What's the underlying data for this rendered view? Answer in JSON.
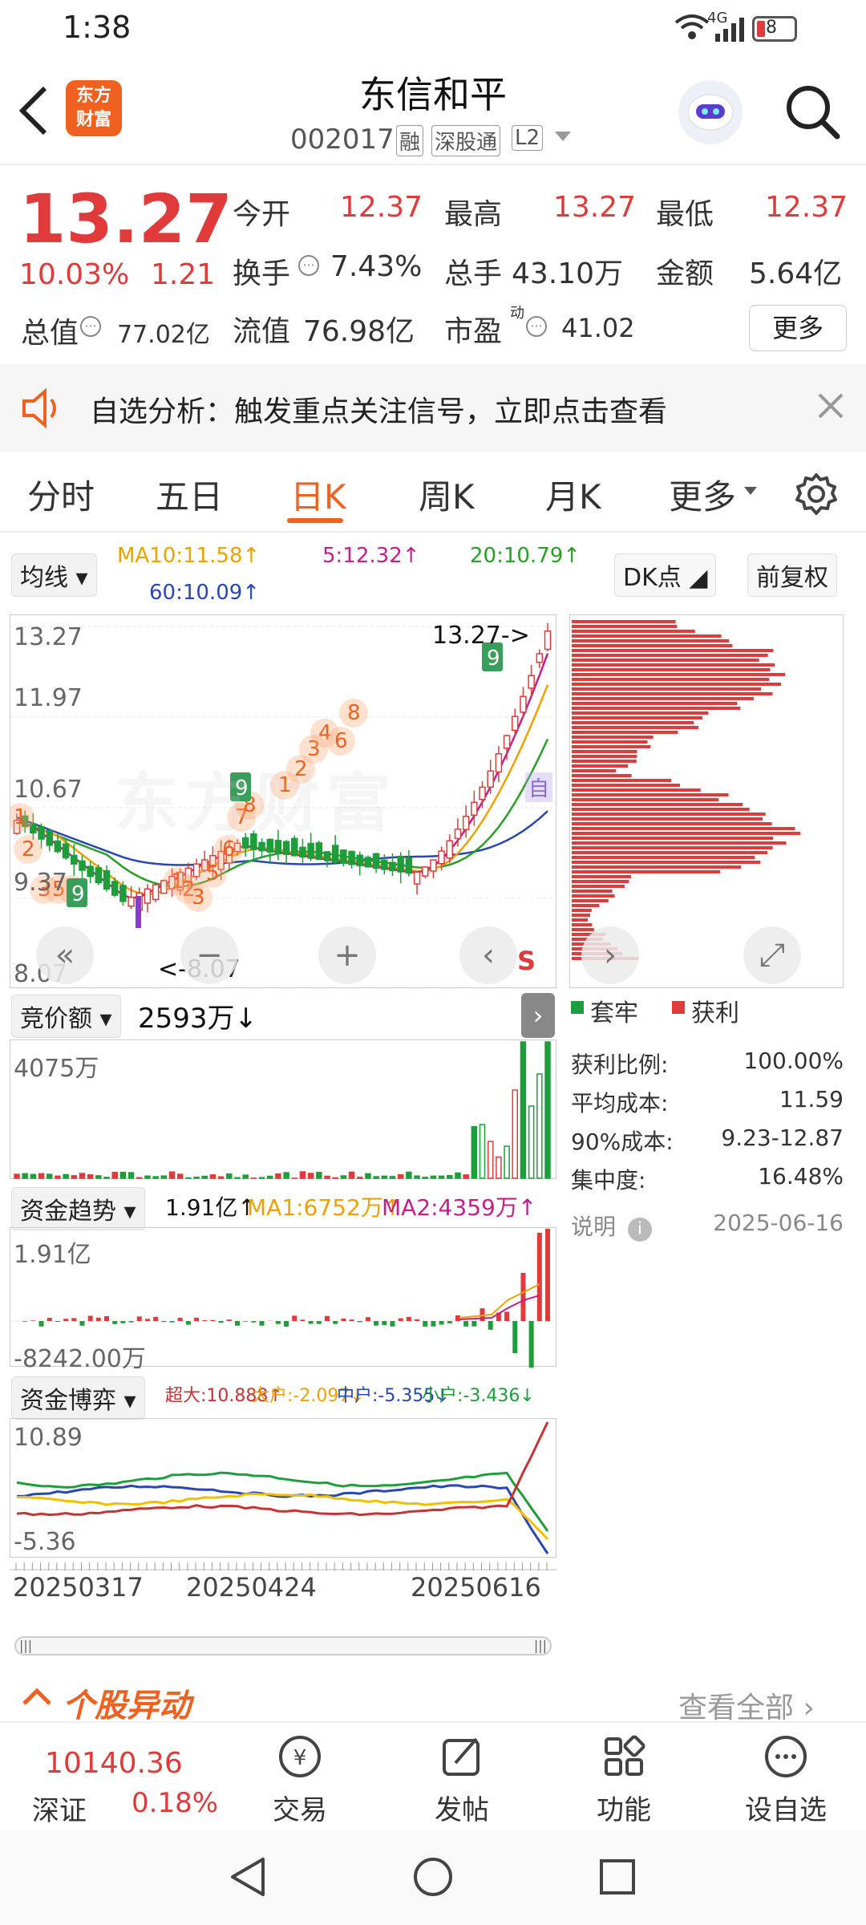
{
  "status_bar": {
    "time": "1:38",
    "network": "4G",
    "battery": "8"
  },
  "header": {
    "title": "东信和平",
    "code": "002017",
    "tags": [
      "融",
      "深股通",
      "L2"
    ],
    "logo_text": [
      "东方",
      "财富"
    ],
    "icons": {
      "back": "back-arrow-icon",
      "search": "search-icon",
      "avatar": "robot-avatar-icon"
    }
  },
  "quote": {
    "price": "13.27",
    "change_pct": "10.03%",
    "change": "1.21",
    "fields": [
      {
        "k": "今开",
        "v": "12.37",
        "red": true
      },
      {
        "k": "最高",
        "v": "13.27",
        "red": true
      },
      {
        "k": "最低",
        "v": "12.37",
        "red": true
      },
      {
        "k": "换手",
        "v": "7.43%"
      },
      {
        "k": "总手",
        "v": "43.10万"
      },
      {
        "k": "金额",
        "v": "5.64亿"
      }
    ],
    "total_value_label": "总值",
    "total_value": "77.02亿",
    "float_value_label": "流值",
    "float_value": "76.98亿",
    "pe_label": "市盈",
    "pe_sup": "动",
    "pe": "41.02",
    "more": "更多"
  },
  "banner": {
    "text": "自选分析：触发重点关注信号，立即点击查看"
  },
  "tabs": {
    "items": [
      "分时",
      "五日",
      "日K",
      "周K",
      "月K",
      "更多"
    ],
    "active": 2
  },
  "kline": {
    "ma_select": "均线",
    "ma10": "MA10:11.58↑",
    "ma5": "5:12.32↑",
    "ma20": "20:10.79↑",
    "ma60": "60:10.09↑",
    "dk": "DK点",
    "adjust": "前复权",
    "y_labels": [
      "13.27",
      "11.97",
      "10.67",
      "9.37",
      "8.07"
    ],
    "high_mark": "13.27->",
    "low_mark": "<-8.07",
    "s_mark": "S",
    "zi_mark": "自",
    "watermark": "东方财富"
  },
  "chip": {
    "legend_trap": "套牢",
    "legend_profit": "获利",
    "stats": [
      {
        "k": "获利比例:",
        "v": "100.00%"
      },
      {
        "k": "平均成本:",
        "v": "11.59"
      },
      {
        "k": "90%成本:",
        "v": "9.23-12.87"
      },
      {
        "k": "集中度:",
        "v": "16.48%"
      }
    ],
    "note": "说明",
    "date": "2025-06-16"
  },
  "auction": {
    "select": "竞价额",
    "value": "2593万↓",
    "max": "4075万"
  },
  "fund_trend": {
    "select": "资金趋势",
    "value": "1.91亿↑",
    "ma1": "MA1:6752万↑",
    "ma2": "MA2:4359万↑",
    "max": "1.91亿",
    "min": "-8242.00万"
  },
  "fund_game": {
    "select": "资金博弈",
    "super": "超大:10.888↑",
    "big": "大户:-2.097↓",
    "mid": "中户:-5.355↓",
    "small": "小户:-3.436↓",
    "max": "10.89",
    "min": "-5.36"
  },
  "x_dates": [
    "20250317",
    "20250424",
    "20250616"
  ],
  "movement": {
    "title": "个股异动",
    "view_all": "查看全部"
  },
  "bottom": {
    "index_value": "10140.36",
    "index_name": "深证",
    "index_pct": "0.18%",
    "items": [
      "交易",
      "发帖",
      "功能",
      "设自选"
    ]
  },
  "colors": {
    "accent": "#f0601e",
    "up": "#e03a3a",
    "down": "#1e9e3a",
    "ma5": "#c81e8c",
    "ma10": "#f0a000",
    "ma20": "#28a028",
    "ma60": "#2846b4"
  }
}
